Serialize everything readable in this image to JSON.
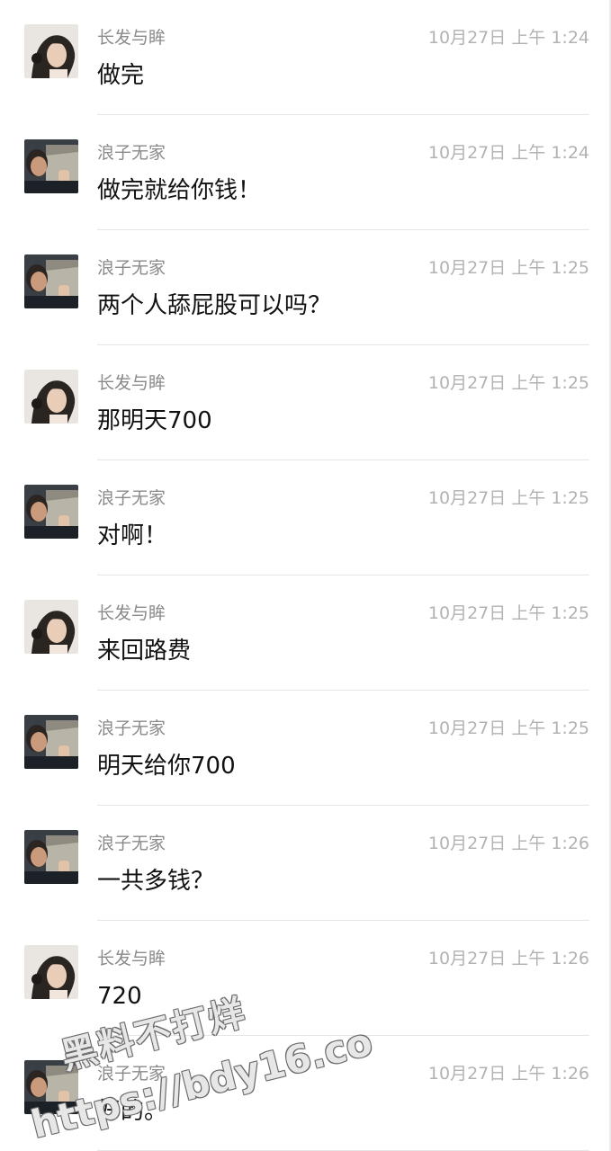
{
  "messages": [
    {
      "sender": "长发与眸",
      "time": "10月27日 上午 1:24",
      "text": "做完",
      "avatar": "woman-avatar"
    },
    {
      "sender": "浪子无家",
      "time": "10月27日 上午 1:24",
      "text": "做完就给你钱！",
      "avatar": "man-avatar"
    },
    {
      "sender": "浪子无家",
      "time": "10月27日 上午 1:25",
      "text": "两个人舔屁股可以吗？",
      "avatar": "man-avatar"
    },
    {
      "sender": "长发与眸",
      "time": "10月27日 上午 1:25",
      "text": "那明天700",
      "avatar": "woman-avatar"
    },
    {
      "sender": "浪子无家",
      "time": "10月27日 上午 1:25",
      "text": "对啊！",
      "avatar": "man-avatar"
    },
    {
      "sender": "长发与眸",
      "time": "10月27日 上午 1:25",
      "text": "来回路费",
      "avatar": "woman-avatar"
    },
    {
      "sender": "浪子无家",
      "time": "10月27日 上午 1:25",
      "text": "明天给你700",
      "avatar": "man-avatar"
    },
    {
      "sender": "浪子无家",
      "time": "10月27日 上午 1:26",
      "text": "一共多钱？",
      "avatar": "man-avatar"
    },
    {
      "sender": "长发与眸",
      "time": "10月27日 上午 1:26",
      "text": "720",
      "avatar": "woman-avatar"
    },
    {
      "sender": "浪子无家",
      "time": "10月27日 上午 1:26",
      "text": "好的。",
      "avatar": "man-avatar"
    }
  ],
  "watermark": {
    "line1": "黑料不打烊",
    "line2": "https://bdy16.co"
  }
}
